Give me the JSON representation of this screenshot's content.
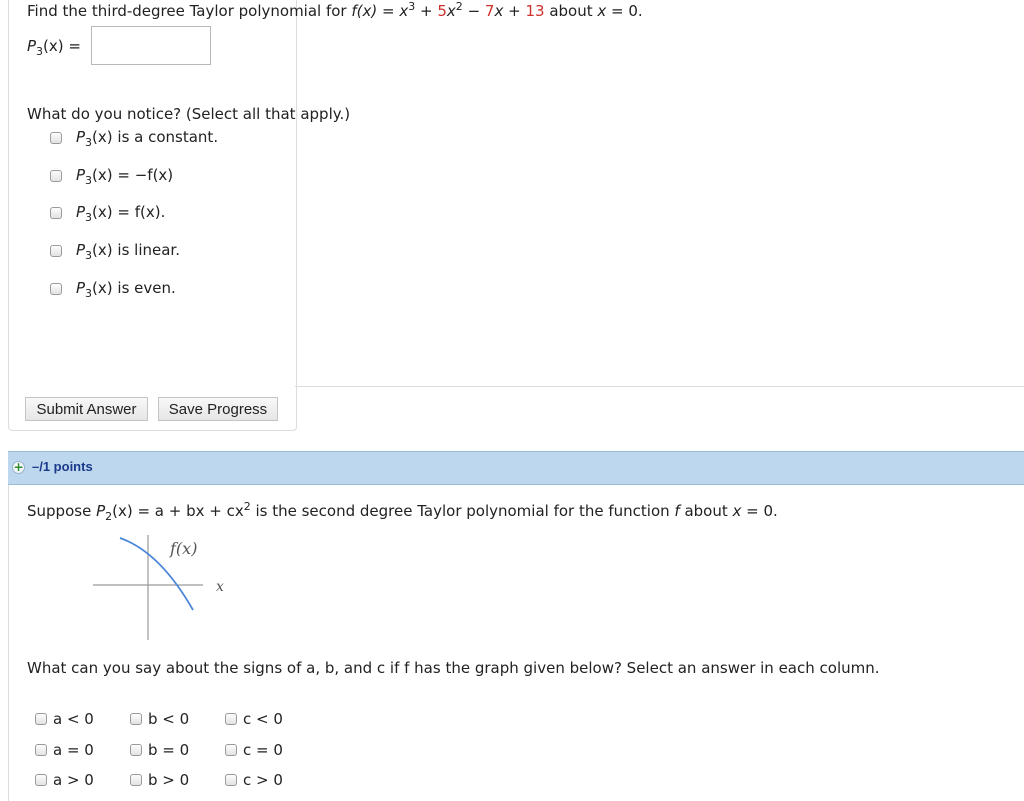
{
  "q1": {
    "prompt_prefix": "Find the third-degree Taylor polynomial for ",
    "fx": "f(x)",
    "eq": " = ",
    "x3": "x",
    "sup3": "3",
    "plus1": " + ",
    "c5": "5",
    "x2": "x",
    "sup2": "2",
    "minus": " − ",
    "c7": "7",
    "xvar": "x",
    "plus2": " + ",
    "c13": "13",
    "about": " about ",
    "x0": "x",
    "eq0": " = 0.",
    "p3_label_P": "P",
    "p3_label_sub": "3",
    "p3_label_rest": "(x) =",
    "answer_value": "",
    "notice_label": "What do you notice? (Select all that apply.)",
    "options": [
      {
        "P": "P",
        "sub": "3",
        "rest": "(x) is a constant."
      },
      {
        "P": "P",
        "sub": "3",
        "rest": "(x) = −f(x)"
      },
      {
        "P": "P",
        "sub": "3",
        "rest": "(x) = f(x)."
      },
      {
        "P": "P",
        "sub": "3",
        "rest": "(x) is linear."
      },
      {
        "P": "P",
        "sub": "3",
        "rest": "(x) is even."
      }
    ],
    "submit_label": "Submit Answer",
    "save_label": "Save Progress"
  },
  "q2": {
    "points": "–/1 points",
    "prompt_a": "Suppose ",
    "P": "P",
    "sub2": "2",
    "prompt_b": "(x) = a + bx + cx",
    "sup2": "2",
    "prompt_c": " is the second degree Taylor polynomial for the function ",
    "f": "f",
    "prompt_d": " about ",
    "x": "x",
    "prompt_e": " = 0.",
    "graph_fx": "f(x)",
    "graph_x": "x",
    "signs_q": "What can you say about the signs of a, b, and c if f has the graph given below? Select an answer in each column.",
    "col_a": [
      "a < 0",
      "a = 0",
      "a > 0"
    ],
    "col_b": [
      "b < 0",
      "b = 0",
      "b > 0"
    ],
    "col_c": [
      "c < 0",
      "c = 0",
      "c > 0"
    ]
  },
  "colors": {
    "accent_red": "#d0312d",
    "points_bar": "#bdd7ee",
    "points_text": "#1a3a8a",
    "curve": "#4a86d8"
  }
}
